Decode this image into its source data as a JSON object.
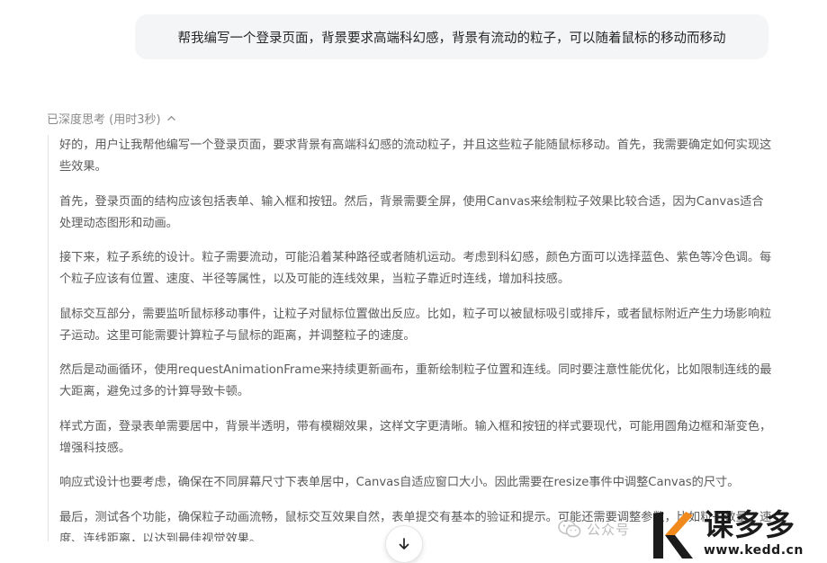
{
  "user_message": "帮我编写一个登录页面，背景要求高端科幻感，背景有流动的粒子，可以随着鼠标的移动而移动",
  "thinking": {
    "header": "已深度思考 (用时3秒)",
    "paragraphs": [
      "好的，用户让我帮他编写一个登录页面，要求背景有高端科幻感的流动粒子，并且这些粒子能随鼠标移动。首先，我需要确定如何实现这些效果。",
      "首先，登录页面的结构应该包括表单、输入框和按钮。然后，背景需要全屏，使用Canvas来绘制粒子效果比较合适，因为Canvas适合处理动态图形和动画。",
      "接下来，粒子系统的设计。粒子需要流动，可能沿着某种路径或者随机运动。考虑到科幻感，颜色方面可以选择蓝色、紫色等冷色调。每个粒子应该有位置、速度、半径等属性，以及可能的连线效果，当粒子靠近时连线，增加科技感。",
      "鼠标交互部分，需要监听鼠标移动事件，让粒子对鼠标位置做出反应。比如，粒子可以被鼠标吸引或排斥，或者鼠标附近产生力场影响粒子运动。这里可能需要计算粒子与鼠标的距离，并调整粒子的速度。",
      "然后是动画循环，使用requestAnimationFrame来持续更新画布，重新绘制粒子位置和连线。同时要注意性能优化，比如限制连线的最大距离，避免过多的计算导致卡顿。",
      "样式方面，登录表单需要居中，背景半透明，带有模糊效果，这样文字更清晰。输入框和按钮的样式要现代，可能用圆角边框和渐变色，增强科技感。",
      "响应式设计也要考虑，确保在不同屏幕尺寸下表单居中，Canvas自适应窗口大小。因此需要在resize事件中调整Canvas的尺寸。",
      "最后，测试各个功能，确保粒子动画流畅，鼠标交互效果自然，表单提交有基本的验证和提示。可能还需要调整参数，比如粒子数量、速度、连线距离，以达到最佳视觉效果。"
    ]
  },
  "watermark": {
    "account": "公众号",
    "brand_name": "课多多",
    "brand_url": "www.kedd.cn"
  },
  "icons": {
    "collapse": "chevron-up-icon",
    "scroll_down": "arrow-down-icon",
    "wechat": "wechat-icon",
    "brand_logo": "k-logo-icon"
  },
  "colors": {
    "bubble_bg": "#f4f5f7",
    "text_primary": "#262626",
    "text_thinking": "#5a5a5a",
    "brand_orange": "#f08a1c"
  }
}
